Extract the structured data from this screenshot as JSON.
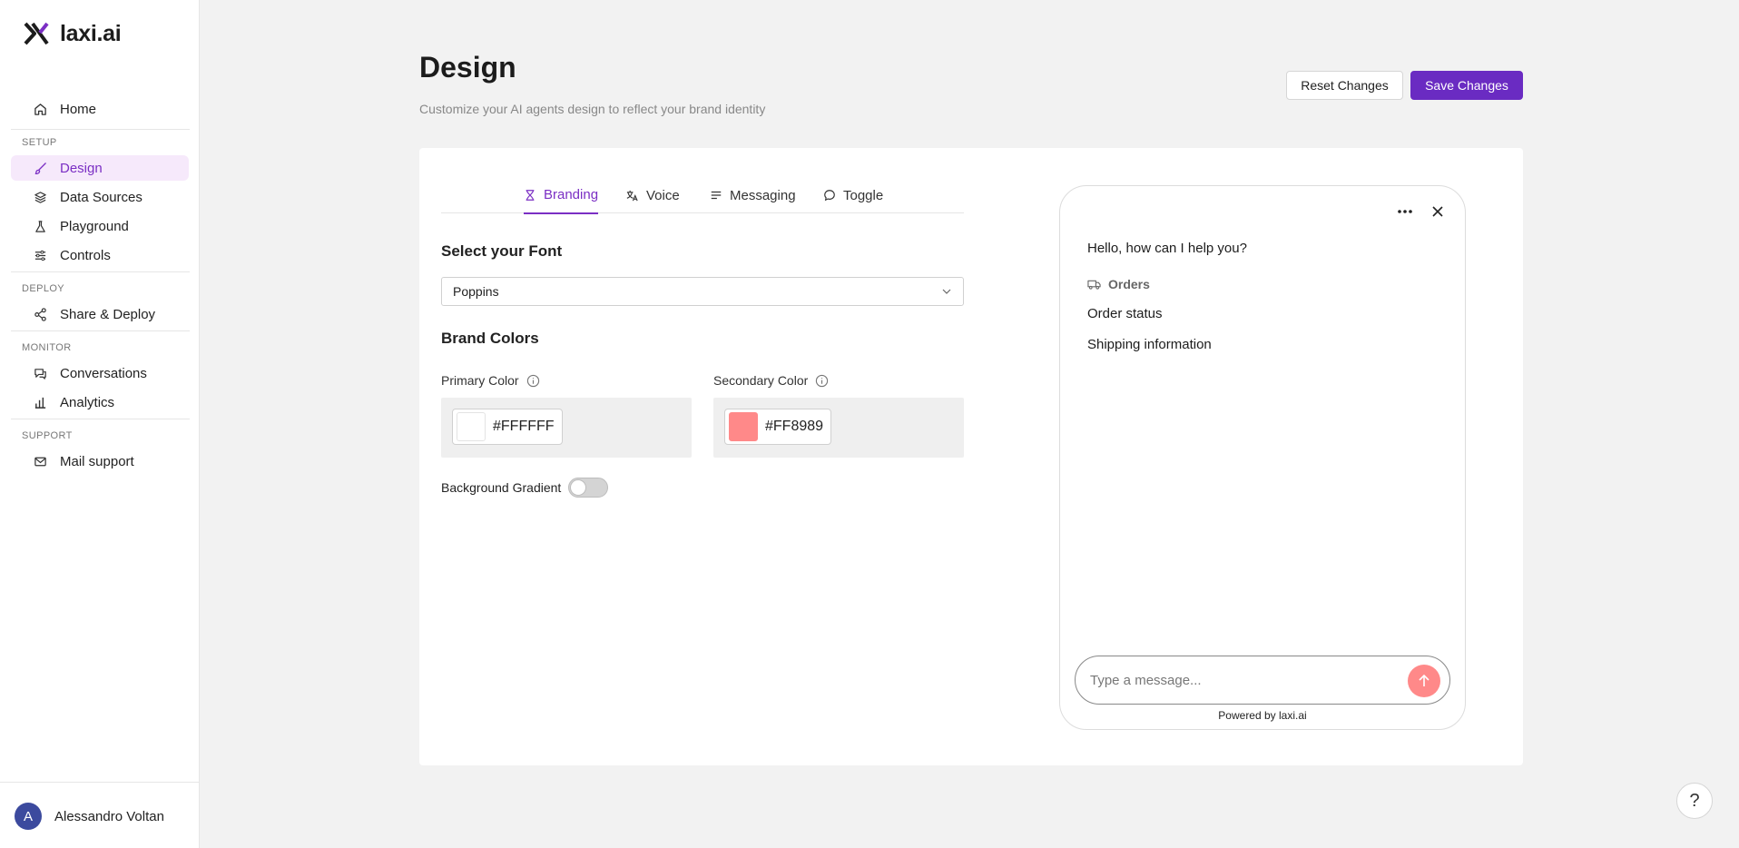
{
  "brand": {
    "name": "laxi.ai",
    "accent": "#6a2bc2"
  },
  "sidebar": {
    "home": "Home",
    "sections": {
      "setup": "SETUP",
      "deploy": "DEPLOY",
      "monitor": "MONITOR",
      "support": "SUPPORT"
    },
    "items": {
      "design": "Design",
      "data_sources": "Data Sources",
      "playground": "Playground",
      "controls": "Controls",
      "share_deploy": "Share & Deploy",
      "conversations": "Conversations",
      "analytics": "Analytics",
      "mail_support": "Mail support"
    },
    "user": {
      "initial": "A",
      "name": "Alessandro Voltan"
    }
  },
  "header": {
    "title": "Design",
    "subtitle": "Customize your AI agents design to reflect your brand identity",
    "reset_label": "Reset Changes",
    "save_label": "Save Changes"
  },
  "tabs": {
    "branding": "Branding",
    "voice": "Voice",
    "messaging": "Messaging",
    "toggle": "Toggle"
  },
  "branding": {
    "font_heading": "Select your Font",
    "font_value": "Poppins",
    "colors_heading": "Brand Colors",
    "primary_label": "Primary Color",
    "primary_value": "#FFFFFF",
    "secondary_label": "Secondary Color",
    "secondary_value": "#FF8989",
    "gradient_label": "Background Gradient",
    "gradient_on": false
  },
  "chat": {
    "greeting": "Hello, how can I help you?",
    "category": "Orders",
    "options": [
      "Order status",
      "Shipping information"
    ],
    "placeholder": "Type a message...",
    "powered_by": "Powered by laxi.ai"
  },
  "help": "?"
}
